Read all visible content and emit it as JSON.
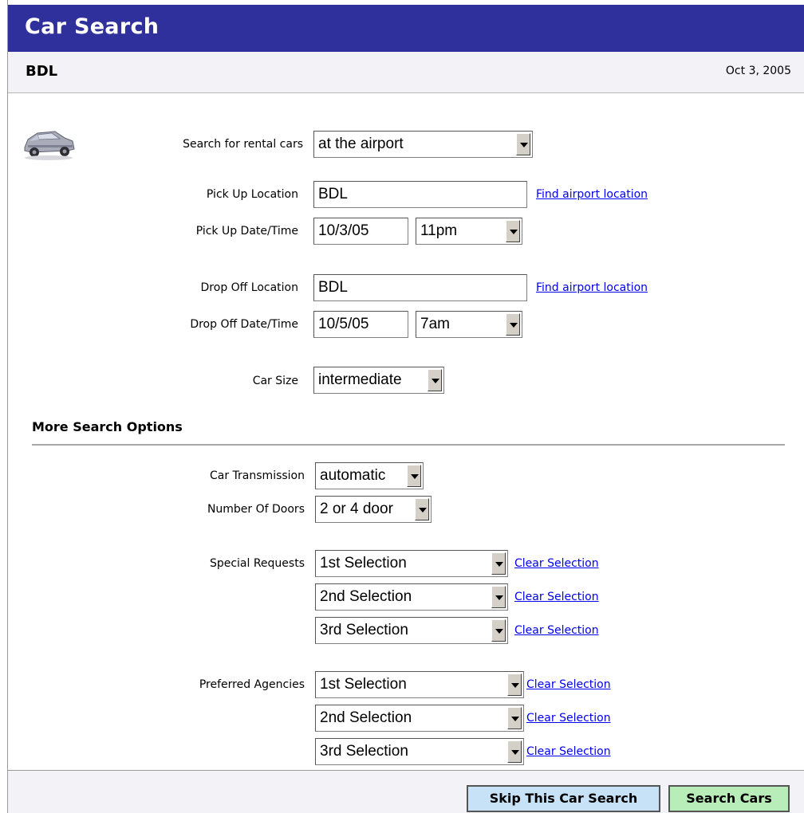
{
  "header": {
    "title": "Car Search"
  },
  "subheader": {
    "code": "BDL",
    "date": "Oct 3, 2005"
  },
  "form": {
    "search_for_label": "Search for rental cars",
    "search_for_value": "at the airport",
    "pickup_location_label": "Pick Up Location",
    "pickup_location_value": "BDL",
    "pickup_datetime_label": "Pick Up Date/Time",
    "pickup_date_value": "10/3/05",
    "pickup_time_value": "11pm",
    "dropoff_location_label": "Drop Off Location",
    "dropoff_location_value": "BDL",
    "dropoff_datetime_label": "Drop Off Date/Time",
    "dropoff_date_value": "10/5/05",
    "dropoff_time_value": "7am",
    "car_size_label": "Car Size",
    "car_size_value": "intermediate",
    "find_airport_link": "Find airport location"
  },
  "more_options": {
    "heading": "More Search Options",
    "transmission_label": "Car Transmission",
    "transmission_value": "automatic",
    "doors_label": "Number Of Doors",
    "doors_value": "2 or 4 door",
    "special_requests_label": "Special Requests",
    "special_requests": [
      "1st Selection",
      "2nd Selection",
      "3rd Selection"
    ],
    "preferred_agencies_label": "Preferred Agencies",
    "preferred_agencies": [
      "1st Selection",
      "2nd Selection",
      "3rd Selection"
    ],
    "clear_selection_label": "Clear Selection"
  },
  "footer": {
    "skip_button": "Skip This Car Search",
    "search_button": "Search Cars"
  },
  "icons": {
    "car": "car-icon"
  },
  "colors": {
    "header_bg": "#30309c",
    "skip_bg": "#c7e1f6",
    "search_bg": "#b8ecb8",
    "link": "#0000ee"
  }
}
